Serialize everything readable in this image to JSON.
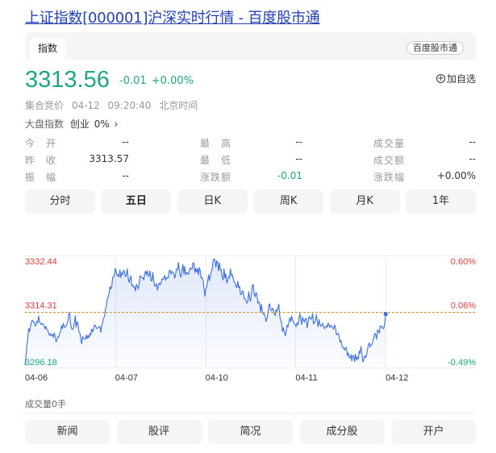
{
  "page": {
    "title": "上证指数[000001]沪深实时行情 - 百度股市通"
  },
  "header": {
    "tab_label": "指数",
    "brand_button": "百度股市通"
  },
  "quote": {
    "price": "3313.56",
    "change": "-0.01",
    "change_pct": "+0.00%",
    "watch_label": "加自选",
    "status": "集合竞价",
    "datetime": "04-12 09:20:40",
    "timezone": "北京时间",
    "market_label": "大盘指数",
    "market_name": "创业",
    "market_value": "0%"
  },
  "stats": {
    "rows": [
      [
        {
          "label": "今　开",
          "value": "--"
        },
        {
          "label": "最　高",
          "value": "--"
        },
        {
          "label": "成交量",
          "value": "--"
        }
      ],
      [
        {
          "label": "昨　收",
          "value": "3313.57"
        },
        {
          "label": "最　低",
          "value": "--"
        },
        {
          "label": "成交额",
          "value": "--"
        }
      ],
      [
        {
          "label": "振　幅",
          "value": "--"
        },
        {
          "label": "涨跌额",
          "value": "-0.01"
        },
        {
          "label": "涨跌幅",
          "value": "+0.00%"
        }
      ]
    ]
  },
  "periods": [
    "分时",
    "五日",
    "日K",
    "周K",
    "月K",
    "1年"
  ],
  "active_period": 1,
  "bottom_tabs": [
    "新闻",
    "股评",
    "简况",
    "成分股",
    "开户"
  ],
  "colors": {
    "up": "#e03b3b",
    "down": "#1fa67a",
    "line": "#3b6fdc",
    "ref": "#d98a2b"
  },
  "chart_data": {
    "type": "line",
    "x_labels": [
      "04-06",
      "04-07",
      "04-10",
      "04-11",
      "04-12"
    ],
    "ylim": [
      3296.18,
      3332.44
    ],
    "reference": 3314.31,
    "left_labels": [
      "3332.44",
      "3314.31",
      "3296.18"
    ],
    "right_labels": [
      "0.60%",
      "0.06%",
      "-0.49%"
    ],
    "volume_label": "成交量0手",
    "series": [
      {
        "values": [
          3297.0,
          3299.5,
          3303.4,
          3305.3,
          3308.8,
          3307.8,
          3309.3,
          3310.9,
          3311.5,
          3311.0,
          3310.9,
          3309.7,
          3309.7,
          3311.2,
          3310.8,
          3312.9,
          3310.9,
          3310.4,
          3310.1,
          3310.5,
          3310.2,
          3309.5,
          3308.7,
          3309.5,
          3308.6,
          3308.2,
          3307.2,
          3306.6,
          3307.2,
          3306.5,
          3306.9,
          3305.9,
          3307.4,
          3306.4,
          3304.5,
          3305.1,
          3306.2,
          3306.1,
          3307.3,
          3307.8,
          3309.8,
          3308.8,
          3310.5,
          3309.4,
          3309.2,
          3309.7,
          3310.3,
          3311.2,
          3313.9,
          3313.6,
          3310.4,
          3308.8,
          3308.5,
          3309.0,
          3310.6,
          3312.9,
          3309.2,
          3311.0,
          3310.3,
          3307.9,
          3307.4,
          3305.8,
          3303.8,
          3306.2,
          3305.7,
          3305.4,
          3305.3,
          3306.7,
          3305.5,
          3306.6,
          3305.8,
          3307.2,
          3306.7,
          3308.7,
          3307.7,
          3308.5,
          3309.9,
          3309.9,
          3309.0,
          3308.8,
          3309.1,
          3309.4,
          3309.5,
          3307.6,
          3309.7,
          3310.6,
          3312.2,
          3312.6,
          3315.0,
          3315.8,
          3318.4,
          3318.8,
          3320.2,
          3322.4,
          3321.6,
          3322.5,
          3325.4,
          3325.4,
          3326.6,
          3328.3,
          3327.0,
          3325.9,
          3326.2,
          3325.5,
          3327.8,
          3325.3,
          3326.9,
          3326.3,
          3327.7,
          3327.1,
          3325.6,
          3326.2,
          3328.1,
          3325.2,
          3323.7,
          3324.8,
          3325.9,
          3322.6,
          3322.9,
          3322.2,
          3322.4,
          3320.9,
          3323.1,
          3322.5,
          3321.6,
          3323.1,
          3325.9,
          3325.5,
          3325.3,
          3325.3,
          3324.6,
          3326.3,
          3327.4,
          3326.2,
          3327.5,
          3325.7,
          3326.0,
          3327.5,
          3324.3,
          3324.2,
          3326.9,
          3324.4,
          3322.5,
          3322.7,
          3323.4,
          3321.2,
          3322.6,
          3323.6,
          3323.0,
          3323.6,
          3324.9,
          3324.6,
          3325.3,
          3326.0,
          3324.4,
          3325.3,
          3325.2,
          3325.2,
          3327.6,
          3327.7,
          3326.5,
          3327.3,
          3327.0,
          3326.6,
          3325.1,
          3326.6,
          3328.0,
          3327.9,
          3330.2,
          3327.8,
          3325.7,
          3325.5,
          3328.1,
          3329.5,
          3326.5,
          3328.9,
          3326.1,
          3326.9,
          3326.8,
          3326.3,
          3327.6,
          3328.5,
          3328.0,
          3328.2,
          3330.1,
          3330.0,
          3327.0,
          3328.3,
          3327.0,
          3328.3,
          3326.2,
          3328.5,
          3327.4,
          3325.1,
          3325.3,
          3324.5,
          3322.0,
          3319.3,
          3321.7,
          3322.2,
          3324.0,
          3326.2,
          3324.3,
          3326.1,
          3327.1,
          3328.2,
          3330.8,
          3331.4,
          3331.0,
          3328.7,
          3330.8,
          3330.1,
          3327.5,
          3330.1,
          3327.7,
          3327.9,
          3325.4,
          3324.5,
          3328.1,
          3325.1,
          3326.5,
          3323.5,
          3324.3,
          3325.6,
          3325.2,
          3328.1,
          3325.9,
          3326.3,
          3325.1,
          3323.8,
          3323.6,
          3322.5,
          3322.1,
          3324.1,
          3322.0,
          3322.5,
          3319.8,
          3319.9,
          3321.0,
          3320.8,
          3318.5,
          3318.5,
          3317.9,
          3317.0,
          3317.6,
          3320.7,
          3318.6,
          3317.6,
          3320.1,
          3322.8,
          3323.0,
          3319.9,
          3319.1,
          3320.5,
          3319.8,
          3317.0,
          3317.5,
          3316.9,
          3314.2,
          3316.6,
          3314.0,
          3313.4,
          3313.6,
          3312.8,
          3311.1,
          3311.9,
          3313.7,
          3316.4,
          3316.8,
          3315.0,
          3314.6,
          3315.4,
          3314.9,
          3313.6,
          3313.0,
          3314.9,
          3314.4,
          3315.5,
          3316.7,
          3312.8,
          3311.4,
          3310.8,
          3307.8,
          3309.1,
          3307.8,
          3306.4,
          3307.7,
          3309.9,
          3309.3,
          3310.9,
          3312.3,
          3311.1,
          3312.9,
          3311.6,
          3311.0,
          3310.3,
          3310.0,
          3309.4,
          3310.7,
          3310.0,
          3312.0,
          3313.7,
          3311.9,
          3310.1,
          3312.5,
          3311.5,
          3310.9,
          3311.9,
          3312.1,
          3309.1,
          3310.7,
          3312.7,
          3312.5,
          3311.8,
          3312.0,
          3313.6,
          3310.3,
          3310.8,
          3311.3,
          3313.3,
          3311.4,
          3309.4,
          3311.7,
          3310.2,
          3309.5,
          3309.9,
          3310.5,
          3309.3,
          3308.8,
          3309.2,
          3309.8,
          3309.2,
          3310.6,
          3309.9,
          3309.2,
          3309.9,
          3309.5,
          3309.1,
          3308.6,
          3310.0,
          3309.3,
          3306.8,
          3307.0,
          3307.3,
          3306.2,
          3304.4,
          3305.0,
          3303.3,
          3302.7,
          3302.5,
          3301.8,
          3302.6,
          3302.7,
          3300.0,
          3300.9,
          3299.5,
          3299.2,
          3300.4,
          3298.3,
          3300.1,
          3300.1,
          3298.1,
          3300.5,
          3298.6,
          3299.6,
          3298.9,
          3301.5,
          3300.8,
          3303.0,
          3300.3,
          3298.0,
          3298.7,
          3300.1,
          3299.4,
          3300.1,
          3301.9,
          3303.4,
          3304.2,
          3302.8,
          3303.5,
          3303.6,
          3304.9,
          3305.7,
          3307.3,
          3306.9,
          3305.3,
          3308.4,
          3308.1,
          3307.3,
          3309.7,
          3309.4,
          3309.5,
          3308.8,
          3308.8,
          3310.8,
          3313.5
        ]
      }
    ]
  }
}
